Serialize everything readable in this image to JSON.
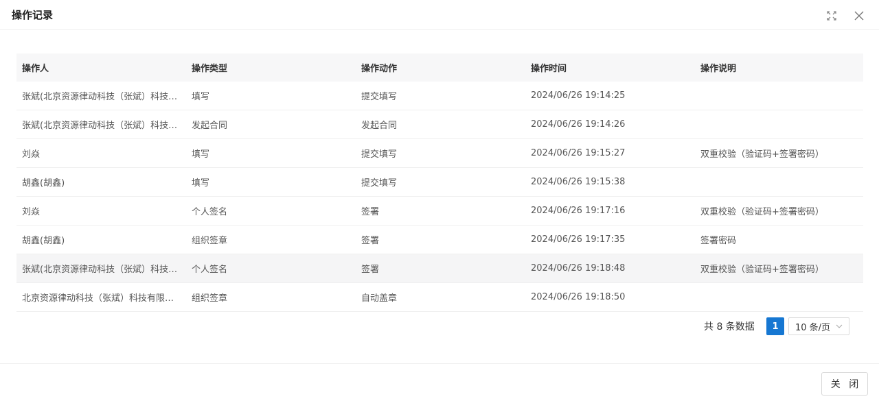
{
  "dialog": {
    "title": "操作记录",
    "close_label": "关 闭"
  },
  "table": {
    "columns": [
      "操作人",
      "操作类型",
      "操作动作",
      "操作时间",
      "操作说明"
    ],
    "rows": [
      [
        "张斌(北京资源律动科技（张斌）科技有限公司)",
        "填写",
        "提交填写",
        "2024/06/26 19:14:25",
        ""
      ],
      [
        "张斌(北京资源律动科技（张斌）科技有限公司)",
        "发起合同",
        "发起合同",
        "2024/06/26 19:14:26",
        ""
      ],
      [
        "刘焱",
        "填写",
        "提交填写",
        "2024/06/26 19:15:27",
        "双重校验（验证码+签署密码）"
      ],
      [
        "胡鑫(胡鑫)",
        "填写",
        "提交填写",
        "2024/06/26 19:15:38",
        ""
      ],
      [
        "刘焱",
        "个人签名",
        "签署",
        "2024/06/26 19:17:16",
        "双重校验（验证码+签署密码）"
      ],
      [
        "胡鑫(胡鑫)",
        "组织签章",
        "签署",
        "2024/06/26 19:17:35",
        "签署密码"
      ],
      [
        "张斌(北京资源律动科技（张斌）科技有限公司)",
        "个人签名",
        "签署",
        "2024/06/26 19:18:48",
        "双重校验（验证码+签署密码）"
      ],
      [
        "北京资源律动科技（张斌）科技有限公司",
        "组织签章",
        "自动盖章",
        "2024/06/26 19:18:50",
        ""
      ]
    ],
    "highlighted_row": 6
  },
  "pagination": {
    "total_text": "共 8 条数据",
    "current_page": "1",
    "page_size": "10 条/页"
  },
  "icons": {
    "fullscreen": "fullscreen-icon",
    "close": "close-icon",
    "chevron": "chevron-down-icon"
  },
  "colors": {
    "accent": "#1677d2",
    "header_bg": "#f7f7f8"
  }
}
